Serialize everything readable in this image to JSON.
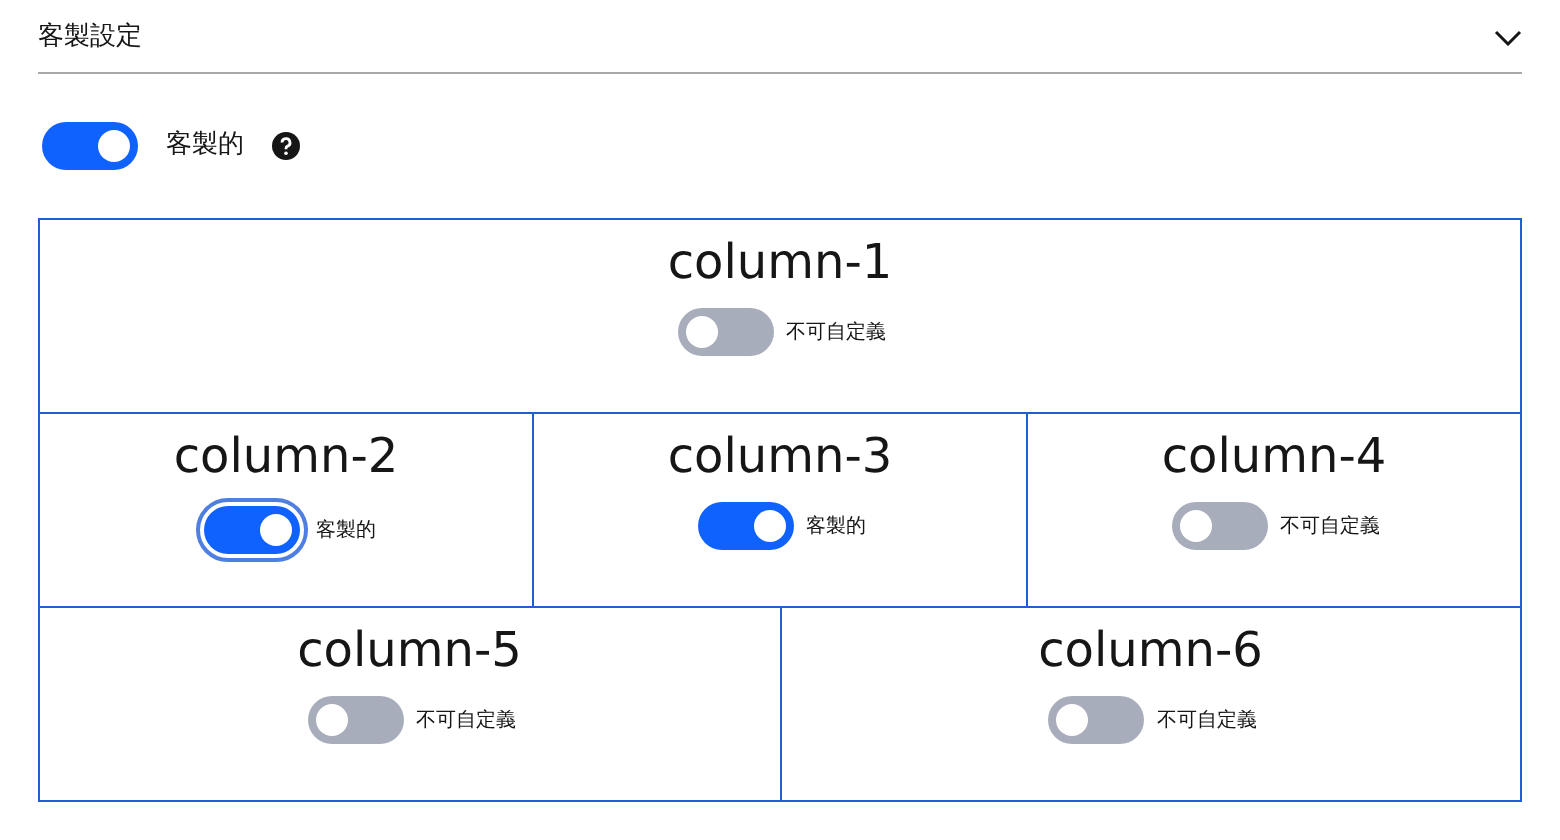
{
  "section": {
    "title": "客製設定",
    "expanded": true
  },
  "main_toggle": {
    "label": "客製的",
    "on": true
  },
  "rows": [
    [
      {
        "title": "column-1",
        "on": false,
        "focused": false,
        "label": "不可自定義"
      }
    ],
    [
      {
        "title": "column-2",
        "on": true,
        "focused": true,
        "label": "客製的"
      },
      {
        "title": "column-3",
        "on": true,
        "focused": false,
        "label": "客製的"
      },
      {
        "title": "column-4",
        "on": false,
        "focused": false,
        "label": "不可自定義"
      }
    ],
    [
      {
        "title": "column-5",
        "on": false,
        "focused": false,
        "label": "不可自定義"
      },
      {
        "title": "column-6",
        "on": false,
        "focused": false,
        "label": "不可自定義"
      }
    ]
  ]
}
